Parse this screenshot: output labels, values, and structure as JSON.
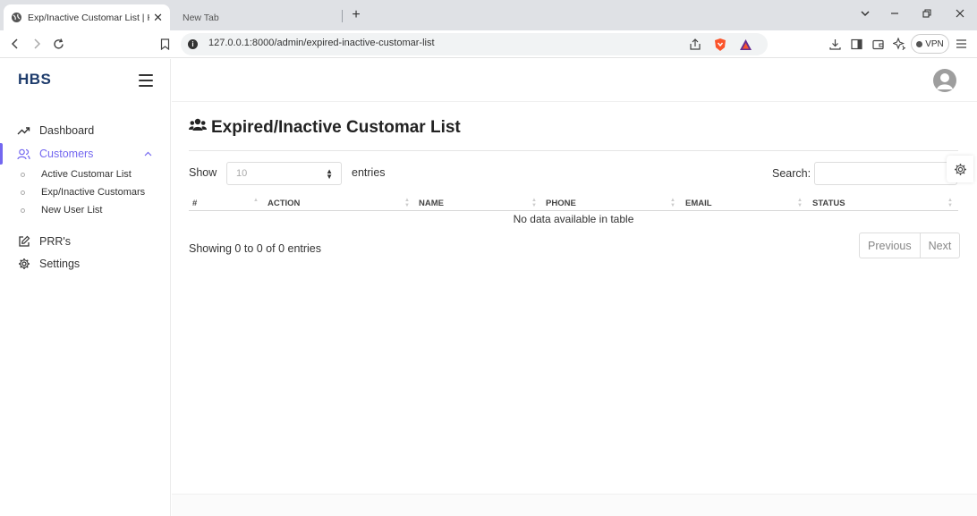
{
  "browser": {
    "tabs": [
      {
        "title": "Exp/Inactive Customar List | HBS"
      },
      {
        "title": "New Tab"
      }
    ],
    "new_tab_symbol": "+",
    "url": "127.0.0.1:8000/admin/expired-inactive-customar-list",
    "vpn_label": "VPN"
  },
  "sidebar": {
    "brand": "HBS",
    "items": [
      {
        "label": "Dashboard",
        "icon": "trending-up-icon"
      },
      {
        "label": "Customers",
        "icon": "users-icon",
        "active": true,
        "expanded": true
      },
      {
        "label": "PRR's",
        "icon": "edit-icon"
      },
      {
        "label": "Settings",
        "icon": "gear-icon"
      }
    ],
    "customers_sub": [
      {
        "label": "Active Customar List"
      },
      {
        "label": "Exp/Inactive Customars"
      },
      {
        "label": "New User List"
      }
    ]
  },
  "page": {
    "title": "Expired/Inactive Customar List",
    "title_icon": "users-icon",
    "show_label": "Show",
    "length_value": "10",
    "entries_label": "entries",
    "search_label": "Search:",
    "table": {
      "columns": [
        "#",
        "ACTION",
        "NAME",
        "PHONE",
        "EMAIL",
        "STATUS"
      ],
      "rows": [],
      "empty_message": "No data available in table"
    },
    "info": "Showing 0 to 0 of 0 entries",
    "pagination": {
      "previous": "Previous",
      "next": "Next"
    }
  },
  "colors": {
    "accent": "#7367f0",
    "brand": "#1d3b6b"
  }
}
